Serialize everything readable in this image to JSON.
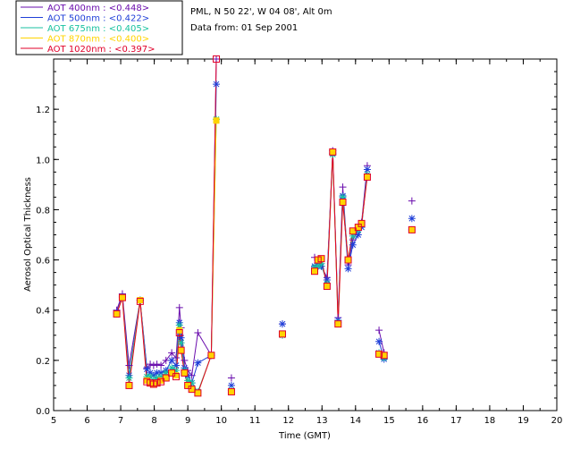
{
  "info": {
    "site": "PML, N 50 22', W 04 08', Alt 0m",
    "date": "Data from: 01 Sep 2001"
  },
  "chart_data": {
    "type": "line",
    "title": "",
    "xlabel": "Time (GMT)",
    "ylabel": "Aerosol Optical Thickness",
    "xlim": [
      5,
      20
    ],
    "ylim": [
      0.0,
      1.4
    ],
    "xticks": [
      "5",
      "6",
      "7",
      "8",
      "9",
      "10",
      "11",
      "12",
      "13",
      "14",
      "15",
      "16",
      "17",
      "18",
      "19",
      "20"
    ],
    "yticks": [
      "0.0",
      "0.2",
      "0.4",
      "0.6",
      "0.8",
      "1.0",
      "1.2"
    ],
    "grid": false,
    "legend_position": "top-left, outside plot",
    "x": [
      6.88,
      7.05,
      7.25,
      7.58,
      7.78,
      7.88,
      7.98,
      8.08,
      8.2,
      8.35,
      8.52,
      8.65,
      8.75,
      8.8,
      8.9,
      9.0,
      9.12,
      9.3,
      9.7,
      9.85,
      10.3,
      11.82,
      12.78,
      12.88,
      12.98,
      13.15,
      13.32,
      13.48,
      13.62,
      13.78,
      13.92,
      14.08,
      14.18,
      14.35,
      14.7,
      14.85,
      15.68
    ],
    "series": [
      {
        "name": "AOT 400nm : <0.448>",
        "color": "#6a0dad",
        "values": [
          0.4,
          0.465,
          0.18,
          0.44,
          0.17,
          0.185,
          0.18,
          0.185,
          0.18,
          0.2,
          0.23,
          0.21,
          0.41,
          0.33,
          0.2,
          0.16,
          0.14,
          0.31,
          0.22,
          1.4,
          0.13,
          0.345,
          0.61,
          0.59,
          0.575,
          0.53,
          1.035,
          0.37,
          0.89,
          0.58,
          0.68,
          0.72,
          0.75,
          0.975,
          0.32,
          0.23,
          0.835
        ]
      },
      {
        "name": "AOT 500nm : <0.422>",
        "color": "#1f3fd8",
        "values": [
          0.39,
          0.455,
          0.14,
          0.44,
          0.165,
          0.15,
          0.14,
          0.15,
          0.15,
          0.16,
          0.2,
          0.18,
          0.35,
          0.29,
          0.17,
          0.14,
          0.11,
          0.19,
          0.22,
          1.3,
          0.1,
          0.345,
          0.575,
          0.575,
          0.575,
          0.52,
          1.025,
          0.36,
          0.855,
          0.565,
          0.66,
          0.7,
          0.73,
          0.96,
          0.275,
          0.205,
          0.765
        ]
      },
      {
        "name": "AOT 675nm : <0.405>",
        "color": "#19c2a0",
        "values": [
          0.385,
          0.45,
          0.13,
          0.44,
          0.135,
          0.135,
          0.12,
          0.13,
          0.135,
          0.15,
          0.17,
          0.16,
          0.34,
          0.27,
          0.16,
          0.12,
          0.11,
          0.075,
          0.22,
          1.16,
          0.08,
          0.3,
          0.57,
          0.575,
          0.585,
          0.505,
          1.02,
          0.35,
          0.85,
          0.6,
          0.695,
          0.72,
          0.74,
          0.94,
          0.23,
          0.21,
          0.72
        ]
      },
      {
        "name": "AOT 870nm : <0.400>",
        "color": "#ffd400",
        "values": [
          0.385,
          0.45,
          0.1,
          0.44,
          0.12,
          0.11,
          0.105,
          0.11,
          0.12,
          0.13,
          0.15,
          0.14,
          0.32,
          0.24,
          0.15,
          0.1,
          0.085,
          0.07,
          0.22,
          1.155,
          0.075,
          0.305,
          0.555,
          0.6,
          0.605,
          0.495,
          1.03,
          0.345,
          0.83,
          0.6,
          0.715,
          0.73,
          0.745,
          0.93,
          0.225,
          0.22,
          0.72
        ]
      },
      {
        "name": "AOT 1020nm : <0.397>",
        "color": "#e0002a",
        "values": [
          0.385,
          0.45,
          0.1,
          0.435,
          0.115,
          0.11,
          0.105,
          0.11,
          0.115,
          0.13,
          0.15,
          0.135,
          0.31,
          0.24,
          0.15,
          0.1,
          0.085,
          0.07,
          0.22,
          1.4,
          0.075,
          0.305,
          0.555,
          0.6,
          0.605,
          0.495,
          1.03,
          0.345,
          0.83,
          0.6,
          0.715,
          0.73,
          0.745,
          0.93,
          0.225,
          0.22,
          0.72
        ]
      }
    ],
    "segments": [
      [
        0,
        19
      ],
      [
        21,
        21
      ],
      [
        22,
        33
      ],
      [
        34,
        35
      ],
      [
        36,
        36
      ]
    ],
    "markers": {
      "AOT 400nm": "plus",
      "AOT 500nm": "asterisk",
      "AOT 870nm": "square",
      "AOT 1020nm": "square-outline"
    }
  }
}
